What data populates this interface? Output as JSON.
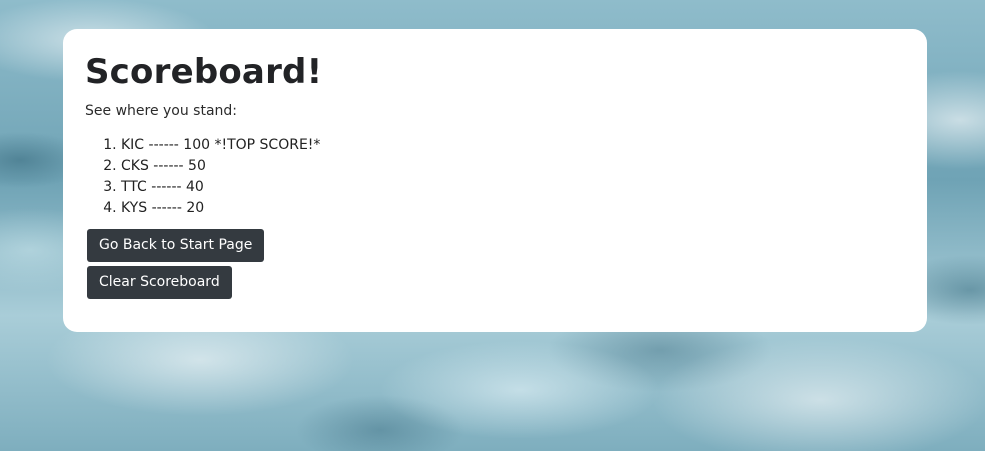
{
  "card": {
    "title": "Scoreboard!",
    "subtitle": "See where you stand:"
  },
  "scores": [
    {
      "text": "KIC ------ 100 *!TOP SCORE!*"
    },
    {
      "text": "CKS ------ 50"
    },
    {
      "text": "TTC ------ 40"
    },
    {
      "text": "KYS ------ 20"
    }
  ],
  "buttons": {
    "back_label": "Go Back to Start Page",
    "clear_label": "Clear Scoreboard"
  },
  "colors": {
    "button_bg": "#343a40",
    "card_bg": "#ffffff",
    "title_text": "#222326"
  }
}
